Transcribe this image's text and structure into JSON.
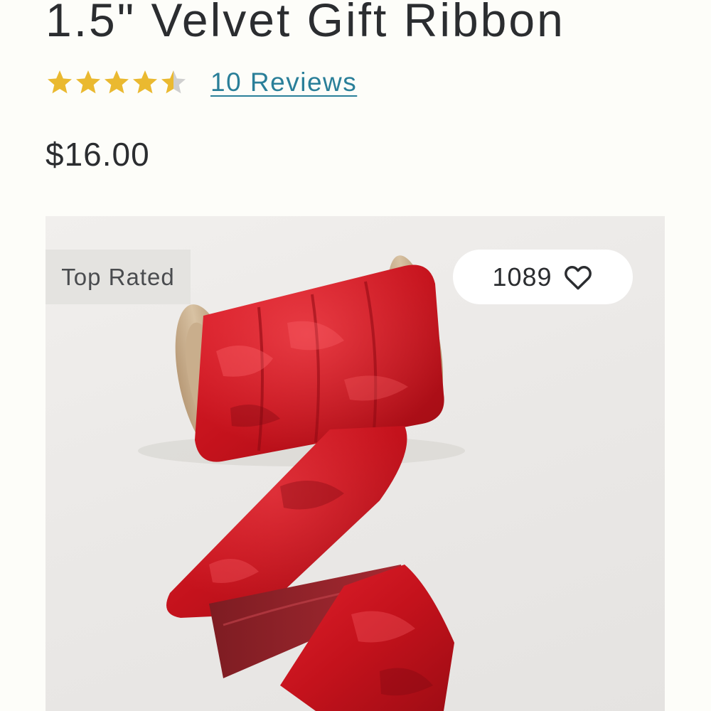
{
  "product": {
    "title": "1.5\" Velvet Gift Ribbon",
    "rating": 4.5,
    "rating_max": 5,
    "reviews_label": "10 Reviews",
    "price": "$16.00"
  },
  "image": {
    "badge": "Top Rated",
    "favorites_count": "1089",
    "favorite_icon": "heart-outline-icon",
    "subject": "red velvet ribbon on wooden spool"
  },
  "colors": {
    "star_filled": "#eab930",
    "star_empty": "#cfcfcf",
    "link": "#2a7f99",
    "text": "#2b2d30",
    "ribbon": "#c8141e",
    "background": "#fdfdf9"
  }
}
